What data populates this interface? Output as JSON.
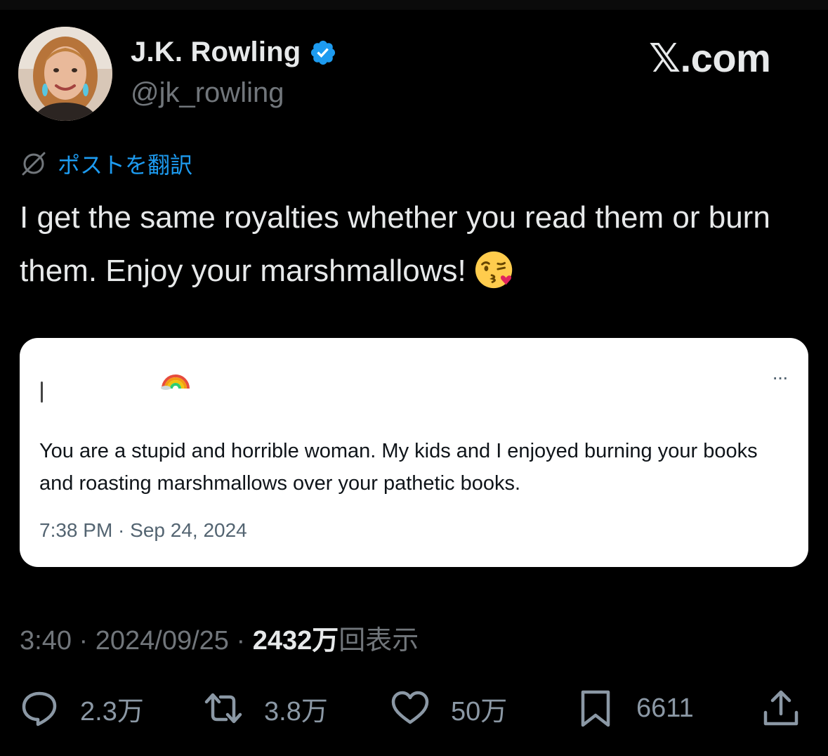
{
  "author": {
    "display_name": "J.K. Rowling",
    "handle": "@jk_rowling",
    "verified": true
  },
  "brand": "𝕏.com",
  "translate_label": "ポストを翻訳",
  "tweet": {
    "text": "I get the same royalties whether you read them or burn them. Enjoy your marshmallows!",
    "emoji": "kissing-face-with-heart"
  },
  "quoted_card": {
    "emoji": "rainbow",
    "more": "···",
    "text": "You are a stupid and horrible woman. My kids and I enjoyed burning your books and roasting marshmallows over your pathetic books.",
    "timestamp": "7:38 PM · Sep 24, 2024"
  },
  "meta": {
    "time": "3:40",
    "separator": " · ",
    "date": "2024/09/25",
    "views_number": "2432",
    "views_unit": "万",
    "views_label": "回表示"
  },
  "actions": {
    "replies": "2.3万",
    "reposts": "3.8万",
    "likes": "50万",
    "bookmarks": "6611"
  },
  "colors": {
    "background": "#000000",
    "text": "#e7e9ea",
    "secondary": "#71767b",
    "link": "#1d9bf0",
    "verified": "#1d9bf0",
    "card_background": "#ffffff"
  }
}
